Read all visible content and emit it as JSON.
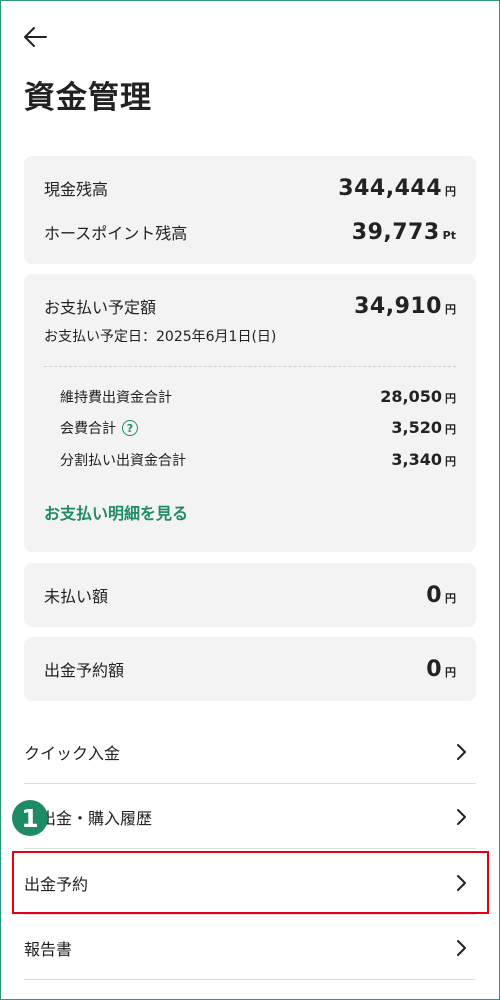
{
  "page": {
    "title": "資金管理"
  },
  "balance": {
    "cash_label": "現金残高",
    "cash_value": "344,444",
    "cash_unit": "円",
    "points_label": "ホースポイント残高",
    "points_value": "39,773",
    "points_unit": "Pt"
  },
  "payment": {
    "label": "お支払い予定額",
    "value": "34,910",
    "unit": "円",
    "date_text": "お支払い予定日：2025年6月1日(日)",
    "items": [
      {
        "label": "維持費出資金合計",
        "value": "28,050",
        "unit": "円"
      },
      {
        "label": "会費合計",
        "value": "3,520",
        "unit": "円"
      },
      {
        "label": "分割払い出資金合計",
        "value": "3,340",
        "unit": "円"
      }
    ],
    "help_icon": "?",
    "details_link": "お支払い明細を見る"
  },
  "unpaid": {
    "label": "未払い額",
    "value": "0",
    "unit": "円"
  },
  "withdrawal_reserved": {
    "label": "出金予約額",
    "value": "0",
    "unit": "円"
  },
  "menu": [
    {
      "label": "クイック入金"
    },
    {
      "label": "入出金・購入履歴"
    },
    {
      "label": "出金予約"
    },
    {
      "label": "報告書"
    }
  ],
  "annotation": {
    "badge_number": "1"
  },
  "colors": {
    "accent": "#1e8a66",
    "highlight": "#e60012",
    "card_bg": "#f3f3f3"
  }
}
